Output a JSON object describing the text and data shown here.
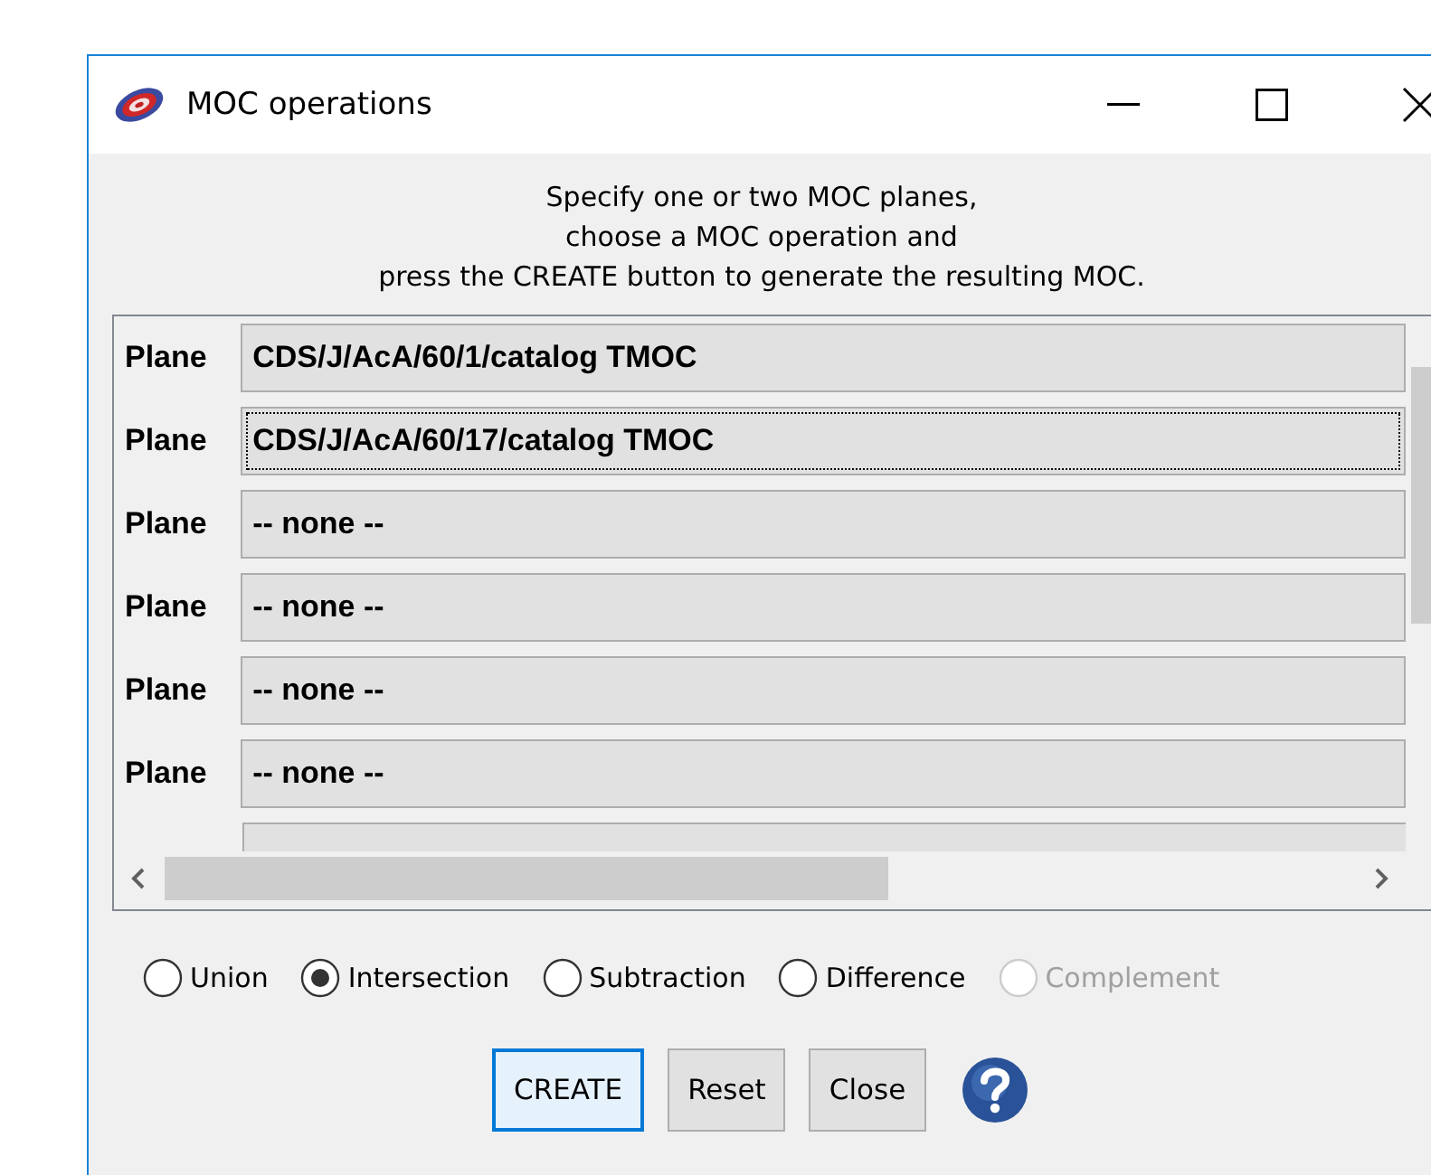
{
  "window": {
    "title": "MOC operations"
  },
  "instructions": [
    "Specify one or two MOC planes,",
    "choose a MOC operation and",
    "press the CREATE button to generate the resulting MOC."
  ],
  "planes": [
    {
      "label": "Plane",
      "value": "CDS/J/AcA/60/1/catalog TMOC",
      "focused": false
    },
    {
      "label": "Plane",
      "value": "CDS/J/AcA/60/17/catalog TMOC",
      "focused": true
    },
    {
      "label": "Plane",
      "value": "-- none --",
      "focused": false
    },
    {
      "label": "Plane",
      "value": "-- none --",
      "focused": false
    },
    {
      "label": "Plane",
      "value": "-- none --",
      "focused": false
    },
    {
      "label": "Plane",
      "value": "-- none --",
      "focused": false
    }
  ],
  "operations": [
    {
      "label": "Union",
      "selected": false,
      "disabled": false
    },
    {
      "label": "Intersection",
      "selected": true,
      "disabled": false
    },
    {
      "label": "Subtraction",
      "selected": false,
      "disabled": false
    },
    {
      "label": "Difference",
      "selected": false,
      "disabled": false
    },
    {
      "label": "Complement",
      "selected": false,
      "disabled": true
    }
  ],
  "buttons": [
    {
      "label": "CREATE",
      "default": true
    },
    {
      "label": "Reset",
      "default": false
    },
    {
      "label": "Close",
      "default": false
    }
  ]
}
